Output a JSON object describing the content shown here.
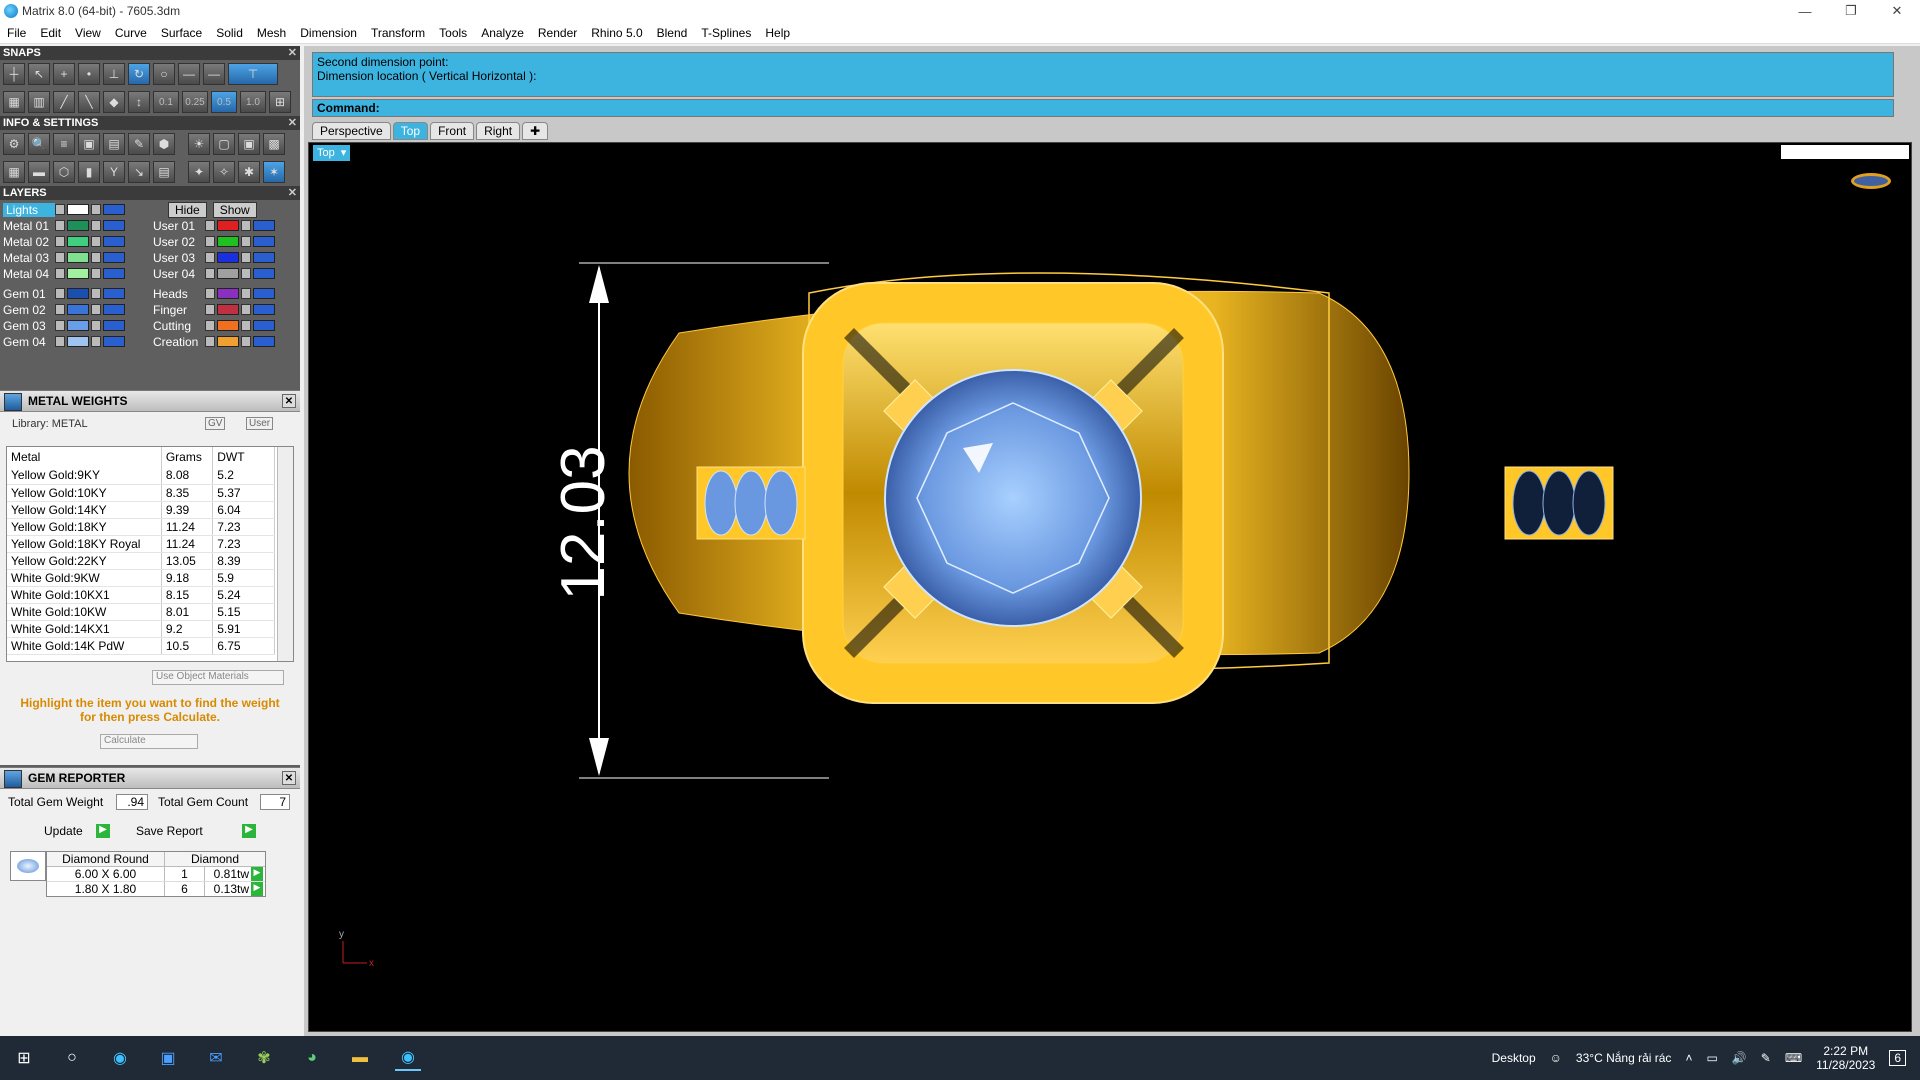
{
  "window": {
    "title": "Matrix 8.0 (64-bit) - 7605.3dm",
    "min": "—",
    "max": "❐",
    "close": "✕"
  },
  "menu": [
    "File",
    "Edit",
    "View",
    "Curve",
    "Surface",
    "Solid",
    "Mesh",
    "Dimension",
    "Transform",
    "Tools",
    "Analyze",
    "Render",
    "Rhino 5.0",
    "Blend",
    "T-Splines",
    "Help"
  ],
  "snaps": {
    "title": "SNAPS",
    "nudge": [
      "0.1",
      "0.25",
      "0.5",
      "1.0"
    ]
  },
  "info": {
    "title": "INFO & SETTINGS"
  },
  "layers": {
    "title": "LAYERS",
    "lights": "Lights",
    "hide": "Hide",
    "show": "Show",
    "left": [
      {
        "name": "Metal 01",
        "color": "#1f8f5a"
      },
      {
        "name": "Metal 02",
        "color": "#3fcf7f"
      },
      {
        "name": "Metal 03",
        "color": "#7fe090"
      },
      {
        "name": "Metal 04",
        "color": "#a0f0a0"
      },
      {
        "name": "Gem 01",
        "color": "#1a4fb0"
      },
      {
        "name": "Gem 02",
        "color": "#3a74d8"
      },
      {
        "name": "Gem 03",
        "color": "#6a9ee8"
      },
      {
        "name": "Gem 04",
        "color": "#a0c4f0"
      }
    ],
    "right": [
      {
        "name": "User 01",
        "color": "#e02020"
      },
      {
        "name": "User 02",
        "color": "#20c020"
      },
      {
        "name": "User 03",
        "color": "#1a2fe0"
      },
      {
        "name": "User 04",
        "color": "#a0a0a0"
      },
      {
        "name": "Heads",
        "color": "#8a2fc0"
      },
      {
        "name": "Finger",
        "color": "#c03040"
      },
      {
        "name": "Cutting",
        "color": "#f07020"
      },
      {
        "name": "Creation",
        "color": "#f0a030"
      }
    ]
  },
  "metal_weights": {
    "title": "METAL WEIGHTS",
    "library": "Library: METAL",
    "gv": "GV",
    "user": "User",
    "columns": [
      "Metal",
      "Grams",
      "DWT"
    ],
    "rows": [
      [
        "Yellow Gold:9KY",
        "8.08",
        "5.2"
      ],
      [
        "Yellow Gold:10KY",
        "8.35",
        "5.37"
      ],
      [
        "Yellow Gold:14KY",
        "9.39",
        "6.04"
      ],
      [
        "Yellow Gold:18KY",
        "11.24",
        "7.23"
      ],
      [
        "Yellow Gold:18KY Royal",
        "11.24",
        "7.23"
      ],
      [
        "Yellow Gold:22KY",
        "13.05",
        "8.39"
      ],
      [
        "White Gold:9KW",
        "9.18",
        "5.9"
      ],
      [
        "White Gold:10KX1",
        "8.15",
        "5.24"
      ],
      [
        "White Gold:10KW",
        "8.01",
        "5.15"
      ],
      [
        "White Gold:14KX1",
        "9.2",
        "5.91"
      ],
      [
        "White Gold:14K PdW",
        "10.5",
        "6.75"
      ]
    ],
    "use_object_materials": "Use Object Materials",
    "hint": "Highlight the item you want to find the weight for then press Calculate.",
    "calculate": "Calculate"
  },
  "gem_reporter": {
    "title": "GEM REPORTER",
    "total_weight_label": "Total Gem Weight",
    "total_weight": ".94",
    "total_count_label": "Total Gem Count",
    "total_count": "7",
    "update": "Update",
    "save_report": "Save Report",
    "columns": [
      "Diamond Round",
      "Diamond"
    ],
    "rows": [
      [
        "6.00 X 6.00",
        "1",
        "0.81tw"
      ],
      [
        "1.80 X 1.80",
        "6",
        "0.13tw"
      ]
    ]
  },
  "command": {
    "line1": "Second dimension point:",
    "line2": "Dimension location ( Vertical  Horizontal ):",
    "prompt": "Command:"
  },
  "tabs": [
    "Perspective",
    "Top",
    "Front",
    "Right"
  ],
  "active_tab": "Top",
  "viewport": {
    "label": "Top",
    "dimension": "12.03",
    "axis_y": "y",
    "axis_x": "x"
  },
  "taskbar": {
    "desktop": "Desktop",
    "weather": "33°C  Nắng rải rác",
    "time": "2:22 PM",
    "date": "11/28/2023",
    "notifications": "6"
  }
}
